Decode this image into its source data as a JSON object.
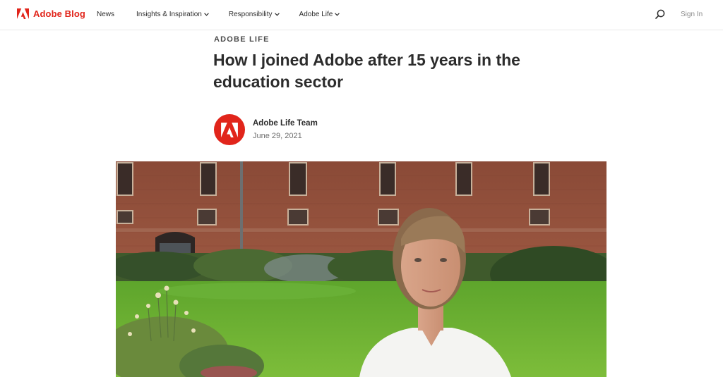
{
  "header": {
    "brand": "Adobe Blog",
    "nav": [
      {
        "label": "News",
        "has_menu": false
      },
      {
        "label": "Insights & Inspiration",
        "has_menu": true
      },
      {
        "label": "Responsibility",
        "has_menu": true
      },
      {
        "label": "Adobe Life",
        "has_menu": true
      }
    ],
    "sign_in": "Sign In",
    "icons": {
      "logo": "adobe-logo-icon",
      "search": "search-icon",
      "menu_chevron": "chevron-down-icon"
    }
  },
  "article": {
    "category": "ADOBE LIFE",
    "title": "How I joined Adobe after 15 years in the education sector",
    "author": "Adobe Life Team",
    "date": "June 29, 2021"
  },
  "colors": {
    "brand": "#e1251b",
    "text": "#2c2c2c",
    "muted": "#6e6e6e"
  }
}
